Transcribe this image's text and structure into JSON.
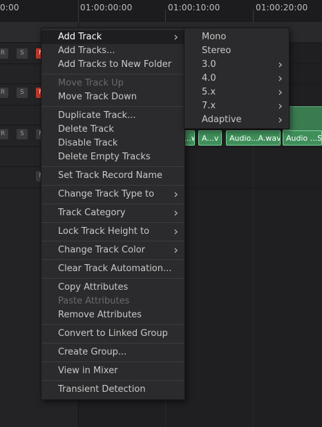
{
  "ruler": {
    "left_timecode": "0:00",
    "timecodes": [
      "01:00:00:00",
      "01:00:10:00",
      "01:00:20:00"
    ]
  },
  "track_buttons": {
    "r": "R",
    "s": "S",
    "m": "M"
  },
  "clips": [
    "A...wav",
    "A...v",
    "Audio...A.wav",
    "Audio ...SA"
  ],
  "context_menu": {
    "groups": [
      [
        {
          "label": "Add Track",
          "submenu": true,
          "highlighted": true
        },
        {
          "label": "Add Tracks..."
        },
        {
          "label": "Add Tracks to New Folder"
        }
      ],
      [
        {
          "label": "Move Track Up",
          "disabled": true
        },
        {
          "label": "Move Track Down"
        }
      ],
      [
        {
          "label": "Duplicate Track..."
        },
        {
          "label": "Delete Track"
        },
        {
          "label": "Disable Track"
        },
        {
          "label": "Delete Empty Tracks"
        }
      ],
      [
        {
          "label": "Set Track Record Name"
        }
      ],
      [
        {
          "label": "Change Track Type to",
          "submenu": true
        }
      ],
      [
        {
          "label": "Track Category",
          "submenu": true
        }
      ],
      [
        {
          "label": "Lock Track Height to",
          "submenu": true
        }
      ],
      [
        {
          "label": "Change Track Color",
          "submenu": true
        }
      ],
      [
        {
          "label": "Clear Track Automation..."
        }
      ],
      [
        {
          "label": "Copy Attributes"
        },
        {
          "label": "Paste Attributes",
          "disabled": true
        },
        {
          "label": "Remove Attributes"
        }
      ],
      [
        {
          "label": "Convert to Linked Group"
        }
      ],
      [
        {
          "label": "Create Group..."
        }
      ],
      [
        {
          "label": "View in Mixer"
        }
      ],
      [
        {
          "label": "Transient Detection"
        }
      ]
    ]
  },
  "add_track_submenu": [
    {
      "label": "Mono"
    },
    {
      "label": "Stereo"
    },
    {
      "label": "3.0",
      "submenu": true
    },
    {
      "label": "4.0",
      "submenu": true
    },
    {
      "label": "5.x",
      "submenu": true
    },
    {
      "label": "7.x",
      "submenu": true
    },
    {
      "label": "Adaptive",
      "submenu": true
    }
  ],
  "icons": {
    "submenu_arrow": "chevron-right-icon"
  },
  "colors": {
    "clip_green": "#3f8f5a",
    "mute_red": "#c0392b",
    "menu_bg": "#2b2b2d"
  }
}
